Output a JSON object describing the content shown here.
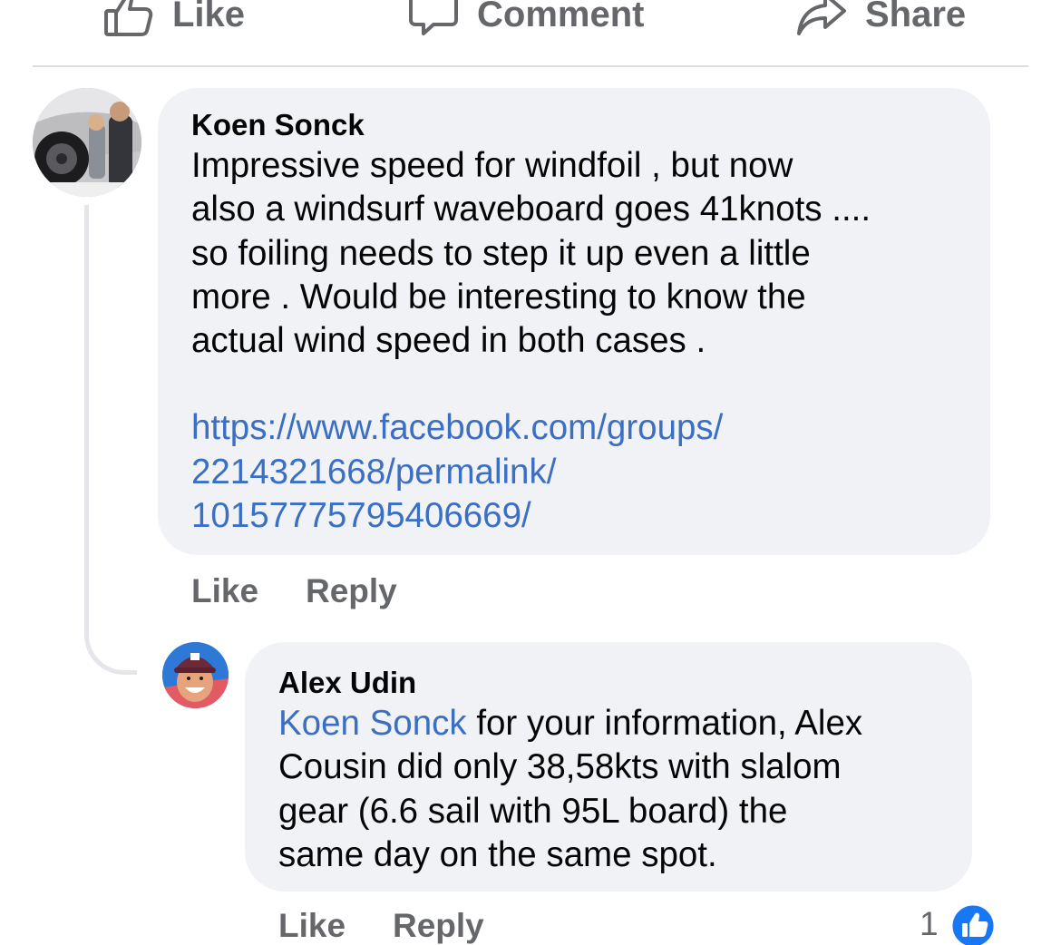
{
  "action_bar": {
    "like_label": "Like",
    "comment_label": "Comment",
    "share_label": "Share"
  },
  "comments": [
    {
      "author": "Koen Sonck",
      "body": "Impressive speed for  windfoil , but now\nalso a windsurf waveboard goes 41knots ....\nso foiling needs to step it up even a little\nmore .  Would be interesting to know the\nactual wind speed in  both cases .",
      "link": "https://www.facebook.com/groups/\n2214321668/permalink/\n10157775795406669/",
      "like_label": "Like",
      "reply_label": "Reply"
    },
    {
      "author": "Alex Udin",
      "mention": "Koen Sonck",
      "body": " for your information, Alex\nCousin did only 38,58kts with slalom\ngear (6.6 sail with 95L board) the\nsame day on the same spot.",
      "like_label": "Like",
      "reply_label": "Reply",
      "reaction_count": "1",
      "reaction_icon": "like-reaction-icon"
    }
  ],
  "colors": {
    "bubble": "#f0f2f5",
    "link": "#3a6fc4",
    "secondary_text": "#65676b",
    "like_blue": "#1877f2"
  }
}
